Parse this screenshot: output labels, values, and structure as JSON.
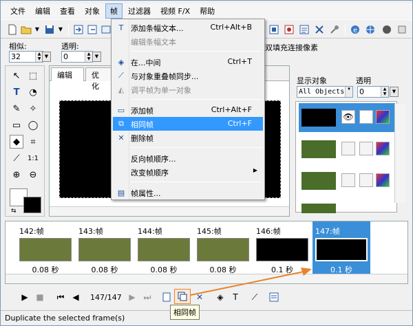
{
  "menubar": {
    "items": [
      "文件",
      "编辑",
      "查看",
      "对象",
      "帧",
      "过滤器",
      "视频 F/X",
      "帮助"
    ],
    "active_index": 4
  },
  "options": {
    "similar_label": "相似:",
    "similar_value": "32",
    "opacity_label": "透明:",
    "opacity_value": "0",
    "fill_text": "双填充连接像素"
  },
  "canvas": {
    "tabs": [
      "编辑",
      "优化"
    ]
  },
  "right_panel": {
    "show_objects_label": "显示对象",
    "opacity_label": "透明",
    "show_objects_value": "All Objects",
    "opacity_value": "0"
  },
  "frames": [
    {
      "header": "142:帧",
      "duration": "0.08 秒",
      "selected": false
    },
    {
      "header": "143:帧",
      "duration": "0.08 秒",
      "selected": false
    },
    {
      "header": "144:帧",
      "duration": "0.08 秒",
      "selected": false
    },
    {
      "header": "145:帧",
      "duration": "0.08 秒",
      "selected": false
    },
    {
      "header": "146:帧",
      "duration": "0.1 秒",
      "selected": false
    },
    {
      "header": "147:帧",
      "duration": "0.1 秒",
      "selected": true
    }
  ],
  "playback": {
    "frame_counter": "147/147"
  },
  "status": {
    "text": "Duplicate the selected frame(s)"
  },
  "tooltip": {
    "text": "相同帧"
  },
  "frame_menu": {
    "items": [
      {
        "label": "添加条幅文本...",
        "shortcut": "Ctrl+Alt+B",
        "icon": "banner-text-icon",
        "disabled": false
      },
      {
        "label": "编辑条幅文本",
        "shortcut": "",
        "icon": "",
        "disabled": true
      },
      {
        "label": "在...中间",
        "shortcut": "Ctrl+T",
        "icon": "tween-icon",
        "disabled": false
      },
      {
        "label": "与对象重叠帧同步...",
        "shortcut": "",
        "icon": "sync-icon",
        "disabled": false
      },
      {
        "label": "调平帧为单一对象",
        "shortcut": "",
        "icon": "flatten-icon",
        "disabled": true
      },
      {
        "label": "添加帧",
        "shortcut": "Ctrl+Alt+F",
        "icon": "add-frame-icon",
        "disabled": false
      },
      {
        "label": "相同帧",
        "shortcut": "Ctrl+F",
        "icon": "duplicate-frame-icon",
        "disabled": false
      },
      {
        "label": "删除帧",
        "shortcut": "",
        "icon": "delete-frame-icon",
        "disabled": false
      },
      {
        "label": "反向帧顺序...",
        "shortcut": "",
        "icon": "",
        "disabled": false
      },
      {
        "label": "改变帧顺序",
        "shortcut": "",
        "icon": "",
        "disabled": false
      },
      {
        "label": "帧属性...",
        "shortcut": "",
        "icon": "frame-properties-icon",
        "disabled": false
      }
    ],
    "highlighted_index": 6
  },
  "colors": {
    "accent": "#3399ff",
    "selection": "#3b8fd9",
    "highlight_border": "#e8842c"
  }
}
